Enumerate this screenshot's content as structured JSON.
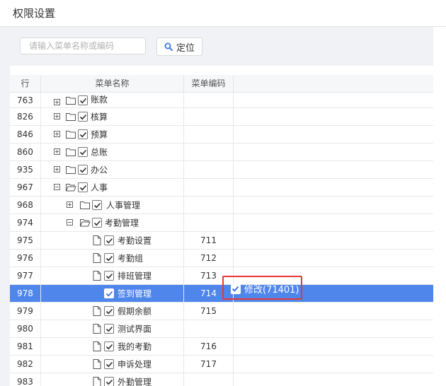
{
  "page_title": "权限设置",
  "search": {
    "placeholder": "请输入菜单名称或编码",
    "button_label": "定位"
  },
  "columns": {
    "line": "行",
    "name": "菜单名称",
    "code": "菜单编码"
  },
  "colors": {
    "selected_row": "#4f86ec",
    "highlight_border": "#e53935",
    "panel_bg": "#f0f2f5"
  },
  "rows": [
    {
      "line": "763",
      "name": "账款",
      "code": "",
      "icon": "folder-icon",
      "expander": "plus",
      "checked": true,
      "selected": false
    },
    {
      "line": "826",
      "name": "核算",
      "code": "",
      "icon": "folder-icon",
      "expander": "plus",
      "checked": true,
      "selected": false
    },
    {
      "line": "846",
      "name": "预算",
      "code": "",
      "icon": "folder-icon",
      "expander": "plus",
      "checked": true,
      "selected": false
    },
    {
      "line": "860",
      "name": "总账",
      "code": "",
      "icon": "folder-icon",
      "expander": "plus",
      "checked": true,
      "selected": false
    },
    {
      "line": "935",
      "name": "办公",
      "code": "",
      "icon": "folder-icon",
      "expander": "plus",
      "checked": true,
      "selected": false
    },
    {
      "line": "967",
      "name": "人事",
      "code": "",
      "icon": "folder-open-icon",
      "expander": "minus",
      "checked": true,
      "selected": false
    },
    {
      "line": "968",
      "name": "人事管理",
      "code": "",
      "icon": "folder-icon",
      "expander": "plus",
      "checked": true,
      "selected": false
    },
    {
      "line": "974",
      "name": "考勤管理",
      "code": "",
      "icon": "folder-open-icon",
      "expander": "minus",
      "checked": true,
      "selected": false
    },
    {
      "line": "975",
      "name": "考勤设置",
      "code": "711",
      "icon": "file-icon",
      "expander": "",
      "checked": true,
      "selected": false
    },
    {
      "line": "976",
      "name": "考勤组",
      "code": "712",
      "icon": "file-icon",
      "expander": "",
      "checked": true,
      "selected": false
    },
    {
      "line": "977",
      "name": "排班管理",
      "code": "713",
      "icon": "file-icon",
      "expander": "",
      "checked": true,
      "selected": false
    },
    {
      "line": "978",
      "name": "签到管理",
      "code": "714",
      "icon": "file-icon",
      "expander": "",
      "checked": true,
      "selected": true,
      "permission": "修改(71401)"
    },
    {
      "line": "979",
      "name": "假期余额",
      "code": "715",
      "icon": "file-icon",
      "expander": "",
      "checked": true,
      "selected": false
    },
    {
      "line": "980",
      "name": "测试界面",
      "code": "",
      "icon": "file-icon",
      "expander": "",
      "checked": true,
      "selected": false
    },
    {
      "line": "981",
      "name": "我的考勤",
      "code": "716",
      "icon": "file-icon",
      "expander": "",
      "checked": true,
      "selected": false
    },
    {
      "line": "982",
      "name": "申诉处理",
      "code": "717",
      "icon": "file-icon",
      "expander": "",
      "checked": true,
      "selected": false
    },
    {
      "line": "983",
      "name": "外勤管理",
      "code": "",
      "icon": "file-icon",
      "expander": "",
      "checked": true,
      "selected": false
    }
  ]
}
